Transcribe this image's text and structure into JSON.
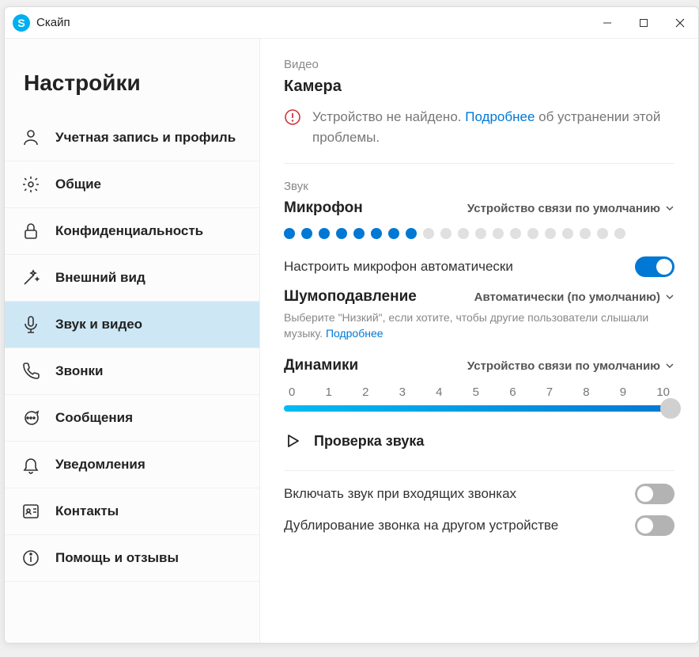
{
  "app": {
    "title": "Скайп",
    "icon_letter": "S"
  },
  "sidebar": {
    "title": "Настройки",
    "items": [
      {
        "label": "Учетная запись и профиль",
        "icon": "user"
      },
      {
        "label": "Общие",
        "icon": "gear"
      },
      {
        "label": "Конфиденциальность",
        "icon": "lock"
      },
      {
        "label": "Внешний вид",
        "icon": "wand"
      },
      {
        "label": "Звук и видео",
        "icon": "mic",
        "active": true
      },
      {
        "label": "Звонки",
        "icon": "phone"
      },
      {
        "label": "Сообщения",
        "icon": "chat"
      },
      {
        "label": "Уведомления",
        "icon": "bell"
      },
      {
        "label": "Контакты",
        "icon": "contacts"
      },
      {
        "label": "Помощь и отзывы",
        "icon": "info"
      }
    ]
  },
  "main": {
    "video": {
      "section_label": "Видео",
      "title": "Камера",
      "warning_prefix": "Устройство не найдено. ",
      "warning_link": "Подробнее",
      "warning_suffix": " об устранении этой проблемы."
    },
    "audio": {
      "section_label": "Звук",
      "microphone": {
        "title": "Микрофон",
        "device": "Устройство связи по умолчанию",
        "level_active": 8,
        "level_total": 20,
        "auto_adjust_label": "Настроить микрофон автоматически",
        "auto_adjust_on": true
      },
      "noise": {
        "title": "Шумоподавление",
        "value": "Автоматически (по умолчанию)",
        "hint_prefix": "Выберите \"Низкий\", если хотите, чтобы другие пользователи слышали музыку. ",
        "hint_link": "Подробнее"
      },
      "speakers": {
        "title": "Динамики",
        "device": "Устройство связи по умолчанию",
        "slider_labels": [
          "0",
          "1",
          "2",
          "3",
          "4",
          "5",
          "6",
          "7",
          "8",
          "9",
          "10"
        ],
        "slider_value": 10
      },
      "test_label": "Проверка звука",
      "ring_incoming": {
        "label": "Включать звук при входящих звонках",
        "on": false
      },
      "ring_duplicate": {
        "label": "Дублирование звонка на другом устройстве",
        "on": false
      }
    }
  }
}
